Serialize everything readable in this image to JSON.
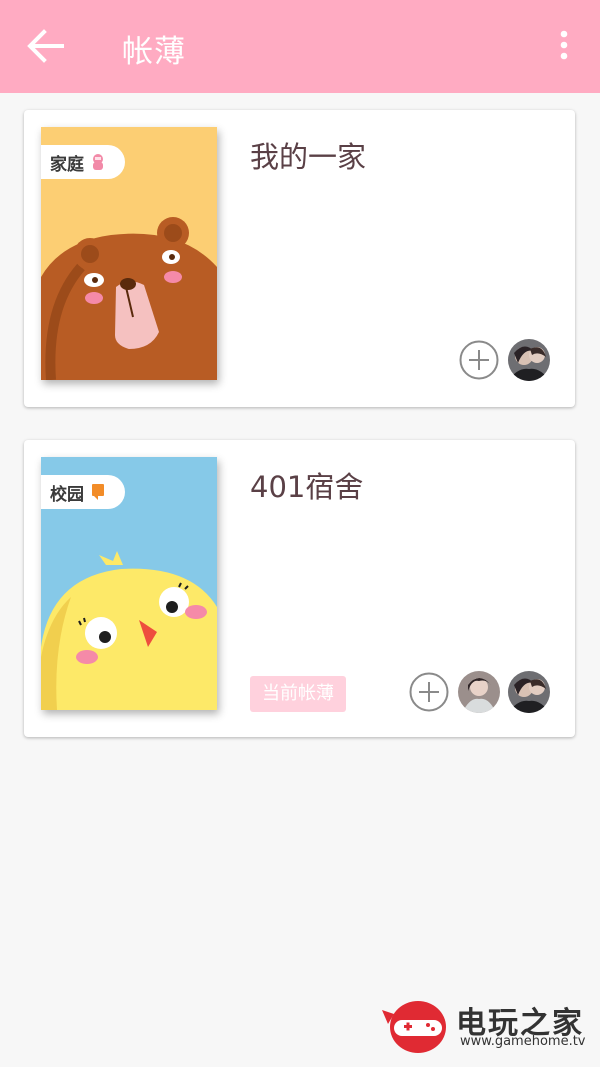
{
  "appbar": {
    "title": "帐薄",
    "back_icon": "arrow-left-icon",
    "more_icon": "more-vert-icon",
    "background": "#ffabc2"
  },
  "books": [
    {
      "title": "我的一家",
      "cover_tag": "家庭",
      "cover_art": "bear",
      "cover_bg": "#fcce73",
      "members": 1,
      "is_current": false
    },
    {
      "title": "401宿舍",
      "cover_tag": "校园",
      "cover_art": "chick",
      "cover_bg": "#86c9e8",
      "members": 2,
      "is_current": true,
      "current_label": "当前帐薄"
    }
  ],
  "watermark": {
    "title": "电玩之家",
    "url": "www.gamehome.tv"
  }
}
